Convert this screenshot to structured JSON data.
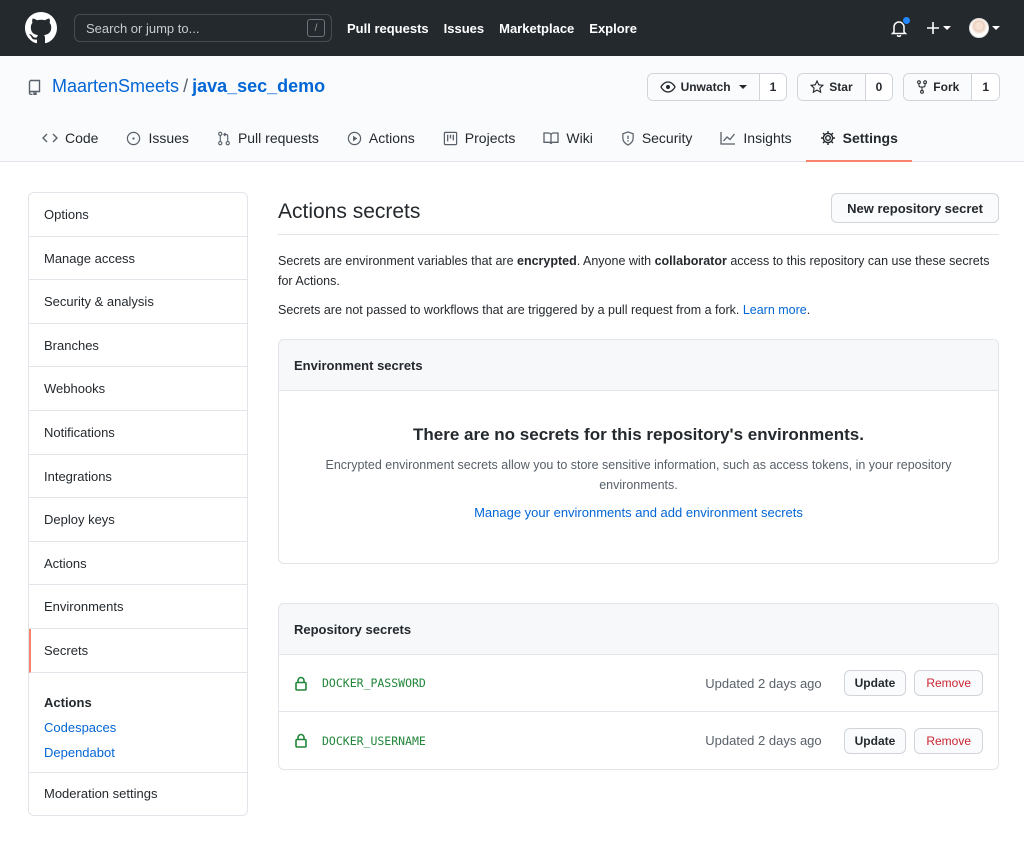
{
  "header": {
    "search_placeholder": "Search or jump to...",
    "search_shortcut": "/",
    "nav": [
      "Pull requests",
      "Issues",
      "Marketplace",
      "Explore"
    ]
  },
  "repo": {
    "owner": "MaartenSmeets",
    "separator": "/",
    "name": "java_sec_demo",
    "watch_label": "Unwatch",
    "watch_count": "1",
    "star_label": "Star",
    "star_count": "0",
    "fork_label": "Fork",
    "fork_count": "1"
  },
  "tabs": [
    {
      "label": "Code",
      "icon": "code-icon"
    },
    {
      "label": "Issues",
      "icon": "issue-icon"
    },
    {
      "label": "Pull requests",
      "icon": "pull-request-icon"
    },
    {
      "label": "Actions",
      "icon": "play-icon"
    },
    {
      "label": "Projects",
      "icon": "project-icon"
    },
    {
      "label": "Wiki",
      "icon": "book-icon"
    },
    {
      "label": "Security",
      "icon": "shield-icon"
    },
    {
      "label": "Insights",
      "icon": "graph-icon"
    },
    {
      "label": "Settings",
      "icon": "gear-icon",
      "selected": true
    }
  ],
  "sidebar": {
    "items": [
      "Options",
      "Manage access",
      "Security & analysis",
      "Branches",
      "Webhooks",
      "Notifications",
      "Integrations",
      "Deploy keys",
      "Actions",
      "Environments",
      "Secrets"
    ],
    "selected": "Secrets",
    "group_header": "Actions",
    "group_links": [
      "Codespaces",
      "Dependabot"
    ],
    "last_item": "Moderation settings"
  },
  "main": {
    "title": "Actions secrets",
    "new_button": "New repository secret",
    "intro_1_a": "Secrets are environment variables that are ",
    "intro_1_b": "encrypted",
    "intro_1_c": ". Anyone with ",
    "intro_1_d": "collaborator",
    "intro_1_e": " access to this repository can use these secrets for Actions.",
    "intro_2": "Secrets are not passed to workflows that are triggered by a pull request from a fork. ",
    "learn_more": "Learn more",
    "intro_2_end": ".",
    "env_box": {
      "header": "Environment secrets",
      "blank_title": "There are no secrets for this repository's environments.",
      "blank_text": "Encrypted environment secrets allow you to store sensitive information, such as access tokens, in your repository environments.",
      "blank_link": "Manage your environments and add environment secrets"
    },
    "repo_box": {
      "header": "Repository secrets",
      "secrets": [
        {
          "name": "DOCKER_PASSWORD",
          "updated": "Updated 2 days ago",
          "update_label": "Update",
          "remove_label": "Remove"
        },
        {
          "name": "DOCKER_USERNAME",
          "updated": "Updated 2 days ago",
          "update_label": "Update",
          "remove_label": "Remove"
        }
      ]
    }
  },
  "colors": {
    "header_bg": "#24292e",
    "accent_tab": "#f9826c",
    "link": "#0366d6",
    "secret_name": "#22863a",
    "danger": "#cb2431"
  }
}
